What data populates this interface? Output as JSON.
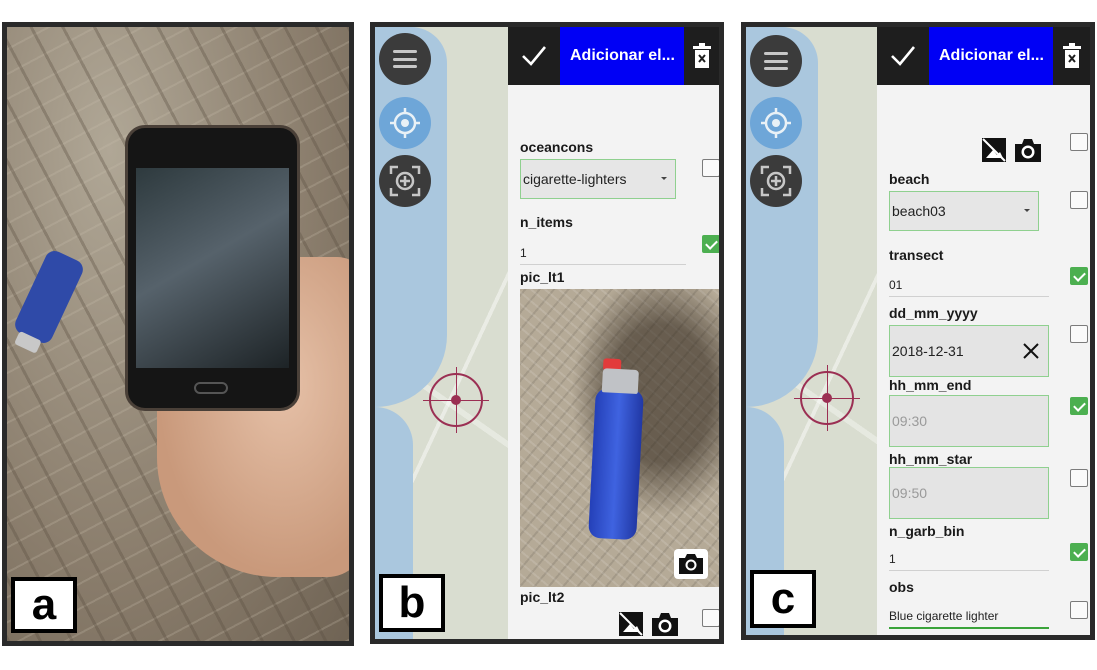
{
  "labels": {
    "a": "a",
    "b": "b",
    "c": "c"
  },
  "form": {
    "header_title": "Adicionar el..."
  },
  "panel_b": {
    "fields": [
      {
        "name": "oceancons",
        "value": "cigarette-lighters",
        "checked": false
      },
      {
        "name": "n_items",
        "value": "1",
        "checked": true
      },
      {
        "name": "pic_lt1",
        "value": "",
        "checked": false
      },
      {
        "name": "pic_lt2",
        "value": "",
        "checked": false
      }
    ]
  },
  "panel_c": {
    "fields": [
      {
        "name": "beach",
        "value": "beach03",
        "checked": false
      },
      {
        "name": "transect",
        "value": "01",
        "checked": true
      },
      {
        "name": "dd_mm_yyyy",
        "value": "2018-12-31",
        "checked": false
      },
      {
        "name": "hh_mm_end",
        "value": "09:30",
        "checked": true
      },
      {
        "name": "hh_mm_star",
        "value": "09:50",
        "checked": false
      },
      {
        "name": "n_garb_bin",
        "value": "1",
        "checked": true
      },
      {
        "name": "obs",
        "value": "Blue cigarette lighter",
        "checked": false
      }
    ],
    "top_checkbox_checked": false
  },
  "icons": {
    "menu": "hamburger-icon",
    "locate": "target-icon",
    "center": "focus-crosshair-icon",
    "confirm": "check-icon",
    "delete": "trash-icon",
    "camera": "camera-icon",
    "no_image": "no-image-icon",
    "clear": "close-icon"
  },
  "colors": {
    "header_bg": "#1e1e1e",
    "title_bg": "#0000f5",
    "check_on": "#4caf50",
    "crosshair": "#9b2f53"
  }
}
